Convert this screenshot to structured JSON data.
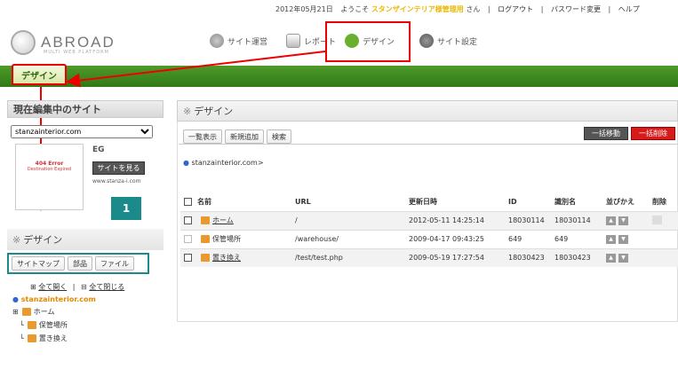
{
  "top": {
    "date": "2012年05月21日",
    "welcome_prefix": "ようこそ",
    "user": "スタンザインテリア様管理用",
    "suffix": "さん",
    "logout": "ログアウト",
    "password": "パスワード変更",
    "help": "ヘルプ"
  },
  "logo": {
    "name": "ABROAD",
    "tagline": "MULTI WEB PLATFORM"
  },
  "nav": {
    "items": [
      {
        "label": "サイト運営"
      },
      {
        "label": "レポート"
      },
      {
        "label": "デザイン"
      },
      {
        "label": "サイト設定"
      }
    ]
  },
  "section_tab": "デザイン",
  "left": {
    "header": "現在編集中のサイト",
    "site_select": "stanzainterior.com",
    "site_code": "EG",
    "thumb_line1": "404 Error",
    "thumb_line2": "Destination Expired",
    "view_btn": "サイトを見る",
    "site_url": "www.stanza-i.com",
    "badge": "1",
    "design_header": "デザイン",
    "tabs": [
      "サイトマップ",
      "部品",
      "ファイル"
    ],
    "expand_all": "全て開く",
    "collapse_all": "全て閉じる",
    "separator": "|",
    "root": "stanzainterior.com",
    "tree": [
      "ホーム",
      "保管場所",
      "置き換え"
    ]
  },
  "main": {
    "title": "デザイン",
    "tabs": [
      "一覧表示",
      "新規追加",
      "検索"
    ],
    "move_btn": "一括移動",
    "delete_btn": "一括削除",
    "breadcrumb": "stanzainterior.com>",
    "columns": [
      "名前",
      "URL",
      "更新日時",
      "ID",
      "識別名",
      "並びかえ",
      "削除"
    ],
    "rows": [
      [
        "ホーム",
        "/",
        "2012-05-11 14:25:14",
        "18030114",
        "18030114"
      ],
      [
        "保管場所",
        "/warehouse/",
        "2009-04-17 09:43:25",
        "649",
        "649"
      ],
      [
        "置き換え",
        "/test/test.php",
        "2009-05-19 17:27:54",
        "18030423",
        "18030423"
      ]
    ]
  },
  "colors": {
    "accent_red": "#e00000",
    "green": "#3a8a1e",
    "teal_box": "#1b8a8a"
  }
}
